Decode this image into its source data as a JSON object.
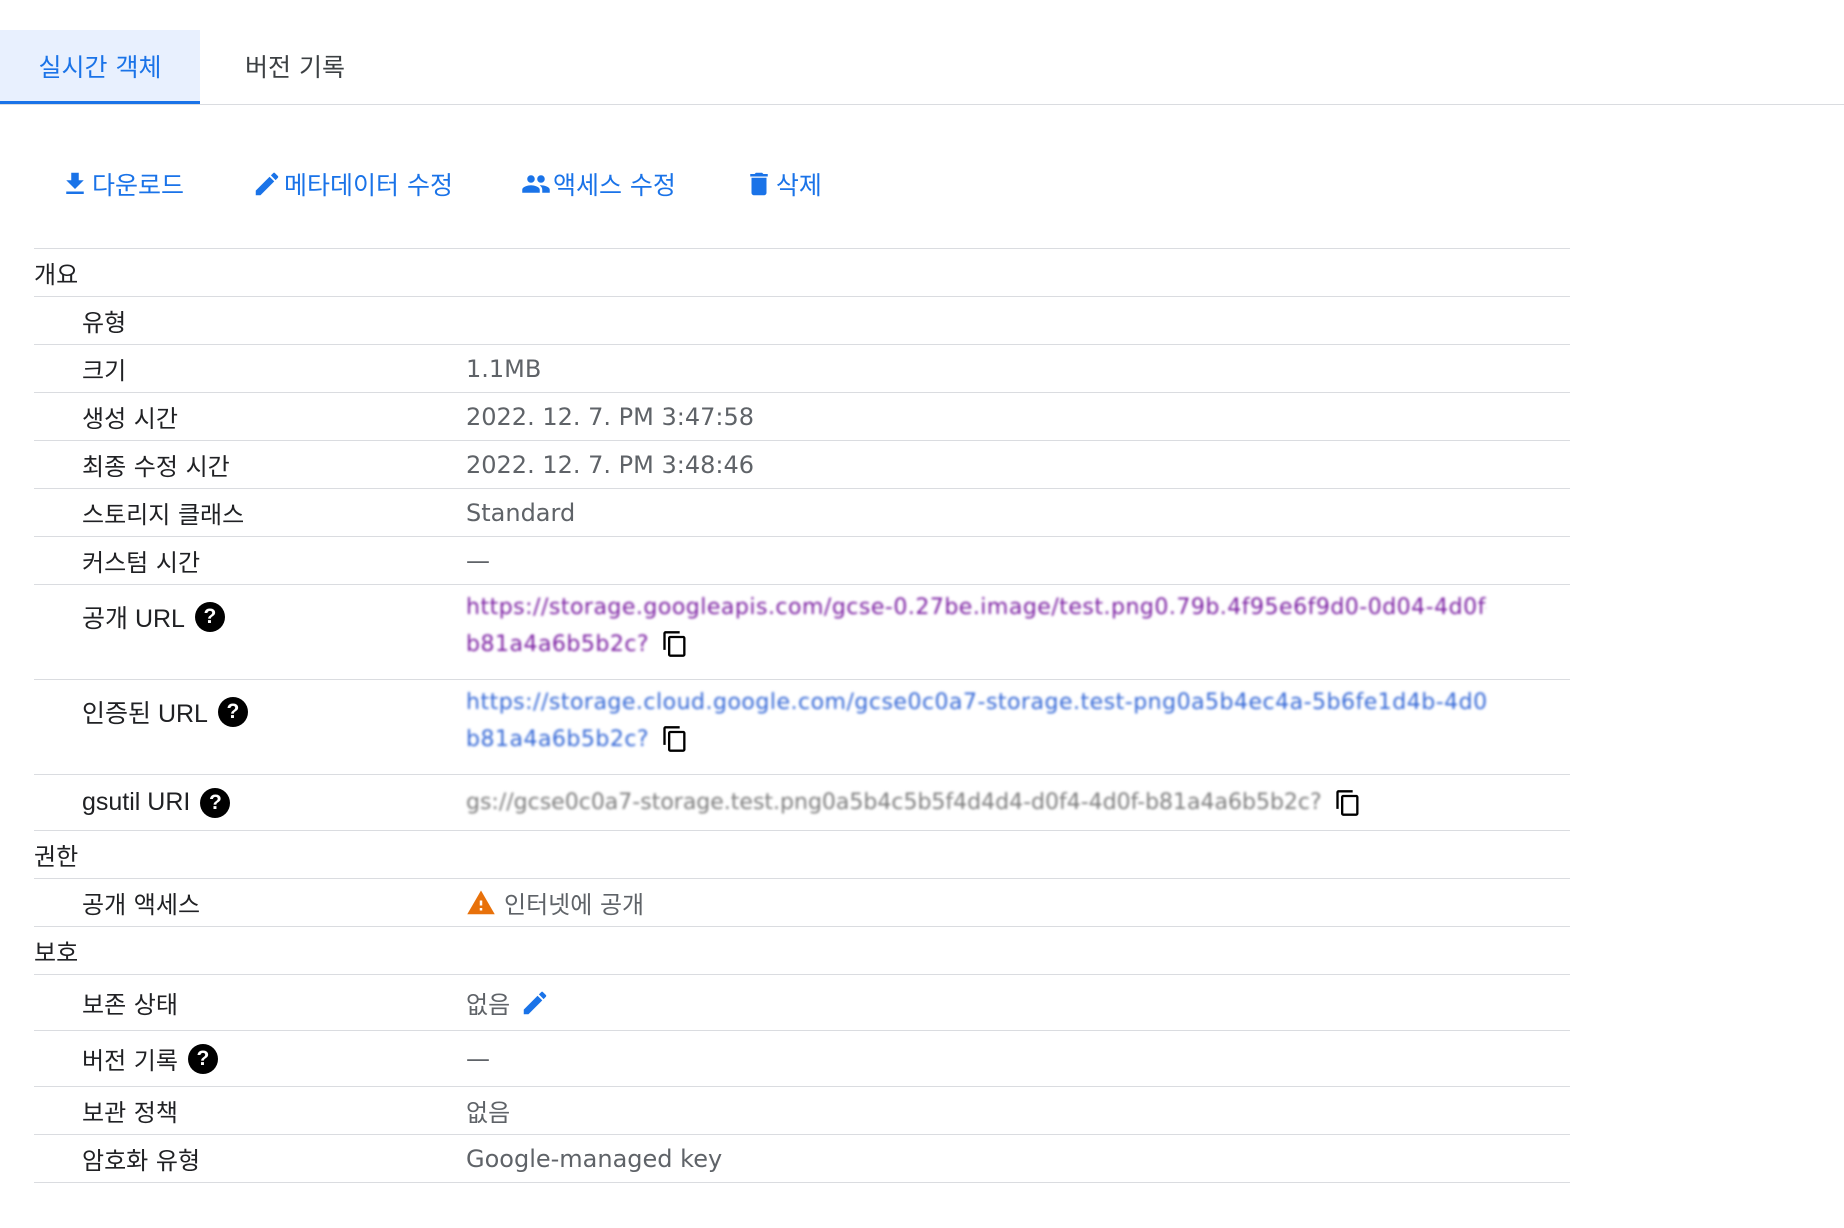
{
  "tabs": [
    {
      "label": "실시간 객체",
      "active": true
    },
    {
      "label": "버전 기록",
      "active": false
    }
  ],
  "toolbar": {
    "download": "다운로드",
    "edit_metadata": "메타데이터 수정",
    "edit_access": "액세스 수정",
    "delete": "삭제"
  },
  "sections": {
    "overview": "개요",
    "permissions": "권한",
    "protection": "보호"
  },
  "overview": {
    "type_label": "유형",
    "type_value": "",
    "size_label": "크기",
    "size_value": "1.1MB",
    "created_label": "생성 시간",
    "created_value": "2022. 12. 7. PM 3:47:58",
    "updated_label": "최종 수정 시간",
    "updated_value": "2022. 12. 7. PM 3:48:46",
    "storage_label": "스토리지 클래스",
    "storage_value": "Standard",
    "custom_time_label": "커스텀 시간",
    "custom_time_value": "—",
    "public_url_label": "공개 URL",
    "public_url_line1": "https://storage.googleapis.com/gcse-0.27be.image/test.png0.79b.4f95e6f9d0-0d04-4d0f-e",
    "public_url_line2": "b81a4a6b5b2c?",
    "auth_url_label": "인증된 URL",
    "auth_url_line1": "https://storage.cloud.google.com/gcse0c0a7-storage.test-png0a5b4ec4a-5b6fe1d4b-4d0f-",
    "auth_url_line2": "b81a4a6b5b2c?",
    "gsutil_label": "gsutil URI",
    "gsutil_value": "gs://gcse0c0a7-storage.test.png0a5b4c5b5f4d4d4-d0f4-4d0f-b81a4a6b5b2c?"
  },
  "permissions": {
    "public_access_label": "공개 액세스",
    "public_access_value": "인터넷에 공개"
  },
  "protection": {
    "hold_label": "보존 상태",
    "hold_value": "없음",
    "versioning_label": "버전 기록",
    "versioning_value": "—",
    "retention_label": "보관 정책",
    "retention_value": "없음",
    "encryption_label": "암호화 유형",
    "encryption_value": "Google-managed key"
  },
  "colors": {
    "accent": "#1a73e8",
    "warning": "#e8710a",
    "link_visited": "#7b1fa2"
  }
}
